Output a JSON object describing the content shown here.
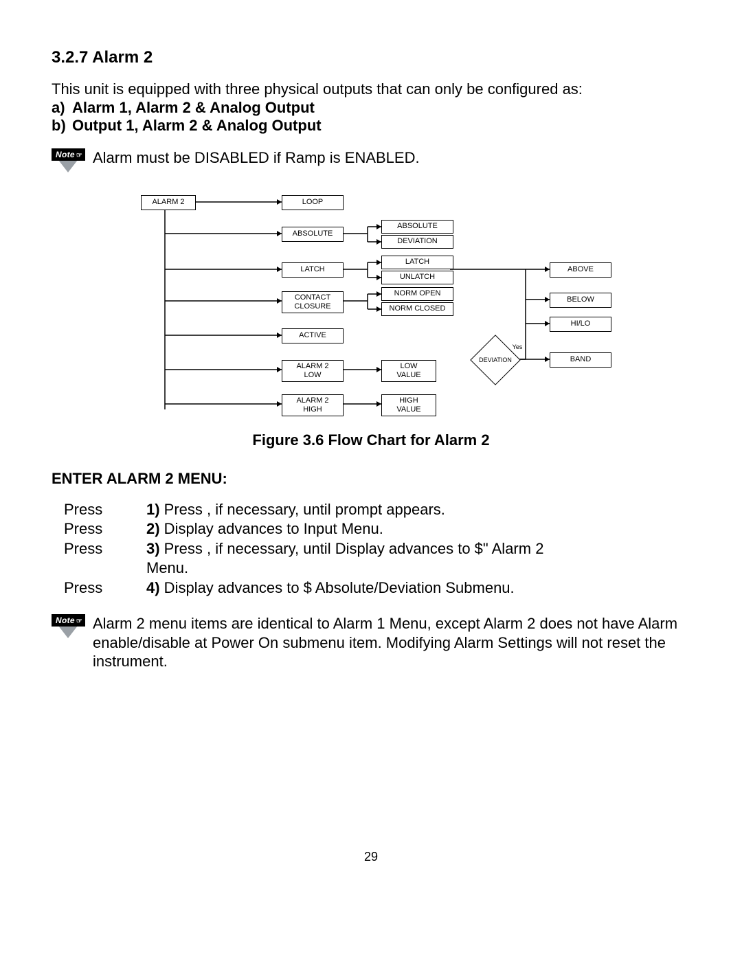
{
  "heading": "3.2.7 Alarm 2",
  "intro": "This unit is equipped with three physical outputs that can only be configured as:",
  "configs": [
    {
      "letter": "a)",
      "text": "Alarm 1, Alarm 2 & Analog Output"
    },
    {
      "letter": "b)",
      "text": "Output 1, Alarm 2 & Analog Output"
    }
  ],
  "note1": "Alarm must be DISABLED if Ramp is ENABLED.",
  "diagram": {
    "boxes": {
      "alarm2": "ALARM 2",
      "loop": "LOOP",
      "absolute_left": "ABSOLUTE",
      "absolute_opt": "ABSOLUTE",
      "deviation_opt": "DEVIATION",
      "latch_left": "LATCH",
      "latch_opt": "LATCH",
      "unlatch_opt": "UNLATCH",
      "contact_closure": "CONTACT\nCLOSURE",
      "norm_open": "NORM OPEN",
      "norm_closed": "NORM CLOSED",
      "active": "ACTIVE",
      "alarm2_low": "ALARM 2\nLOW",
      "low_value": "LOW\nVALUE",
      "alarm2_high": "ALARM 2\nHIGH",
      "high_value": "HIGH\nVALUE",
      "above": "ABOVE",
      "below": "BELOW",
      "hilo": "HI/LO",
      "band": "BAND",
      "deviation_decision": "DEVIATION",
      "yes": "Yes"
    }
  },
  "figure_caption": "Figure 3.6 Flow Chart for Alarm 2",
  "subheading": "ENTER ALARM 2 MENU:",
  "steps": [
    {
      "press": "Press",
      "num": "1)",
      "body_a": " Press    , if necessary, until ",
      "body_b": "       prompt appears."
    },
    {
      "press": "Press",
      "num": "2)",
      "body_a": " Display advances to ",
      "body_b": "        Input Menu."
    },
    {
      "press": "Press",
      "num": "3)",
      "body_a": " Press    , if necessary, until Display advances to $\"",
      "body_b": "        Alarm 2"
    },
    {
      "press": "",
      "num": "",
      "body_a": "Menu.",
      "body_b": ""
    },
    {
      "press": "Press",
      "num": "4)",
      "body_a": " Display advances to $",
      "body_b": "        Absolute/Deviation Submenu."
    }
  ],
  "note2": "Alarm 2 menu items are identical to Alarm 1 Menu, except Alarm 2 does not have Alarm enable/disable at Power On submenu item. Modifying Alarm Settings will not reset the instrument.",
  "note_label": "Note",
  "page_number": "29"
}
